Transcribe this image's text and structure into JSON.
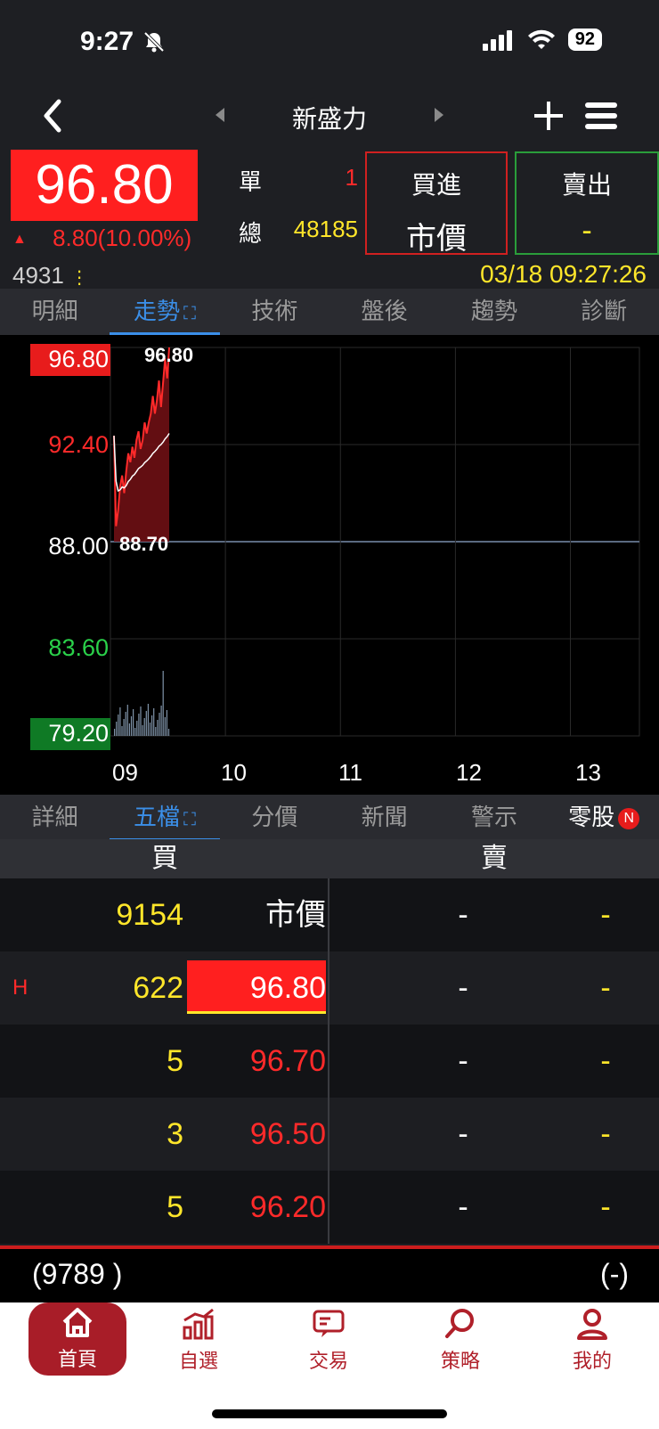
{
  "status": {
    "time": "9:27",
    "battery": "92"
  },
  "nav": {
    "title": "新盛力"
  },
  "quote": {
    "price": "96.80",
    "change": "8.80(10.00%)",
    "single_label": "單",
    "single_value": "1",
    "total_label": "總",
    "total_value": "48185",
    "buy_top": "買進",
    "buy_bottom": "市價",
    "sell_top": "賣出",
    "sell_bottom": "-",
    "code": "4931",
    "datetime": "03/18 09:27:26"
  },
  "tabs_top": [
    "明細",
    "走勢",
    "技術",
    "盤後",
    "趨勢",
    "診斷"
  ],
  "tabs_bottom": [
    "詳細",
    "五檔",
    "分價",
    "新聞",
    "警示",
    "零股"
  ],
  "new_badge": "N",
  "chart_data": {
    "type": "line",
    "y_labels": [
      "96.80",
      "92.40",
      "88.00",
      "83.60",
      "79.20"
    ],
    "x_labels": [
      "09",
      "10",
      "11",
      "12",
      "13"
    ],
    "ylim": [
      79.2,
      96.8
    ],
    "reference": 88.0,
    "high_label": "96.80",
    "low_label": "88.70",
    "series": [
      {
        "x": [
          0,
          1,
          2,
          3,
          4,
          5,
          6,
          7,
          8,
          9,
          10,
          11,
          12,
          13,
          14,
          15,
          16,
          17,
          18,
          19,
          20,
          21,
          22,
          23,
          24,
          25,
          26,
          27
        ],
        "values": [
          92.8,
          88.7,
          89.4,
          90.5,
          91.0,
          90.2,
          91.2,
          92.0,
          91.6,
          92.3,
          91.8,
          92.6,
          93.0,
          92.2,
          92.6,
          93.4,
          92.9,
          93.4,
          93.8,
          94.6,
          93.8,
          94.4,
          95.3,
          94.1,
          95.2,
          96.3,
          95.4,
          96.8
        ]
      }
    ]
  },
  "book": {
    "buy_header": "買",
    "sell_header": "賣",
    "rows": [
      {
        "flag": "",
        "qty": "9154",
        "price": "市價",
        "sell_price": "-",
        "sell_qty": "-"
      },
      {
        "flag": "H",
        "qty": "622",
        "price": "96.80",
        "sell_price": "-",
        "sell_qty": "-"
      },
      {
        "flag": "",
        "qty": "5",
        "price": "96.70",
        "sell_price": "-",
        "sell_qty": "-"
      },
      {
        "flag": "",
        "qty": "3",
        "price": "96.50",
        "sell_price": "-",
        "sell_qty": "-"
      },
      {
        "flag": "",
        "qty": "5",
        "price": "96.20",
        "sell_price": "-",
        "sell_qty": "-"
      }
    ],
    "footer_left": "(9789 )",
    "footer_right": "(-)"
  },
  "bottom_nav": [
    "首頁",
    "自選",
    "交易",
    "策略",
    "我的"
  ],
  "colors": {
    "up": "#ff2a2a",
    "down": "#2ad14a",
    "accent": "#3b8fe8",
    "volume": "#ffe62a"
  }
}
